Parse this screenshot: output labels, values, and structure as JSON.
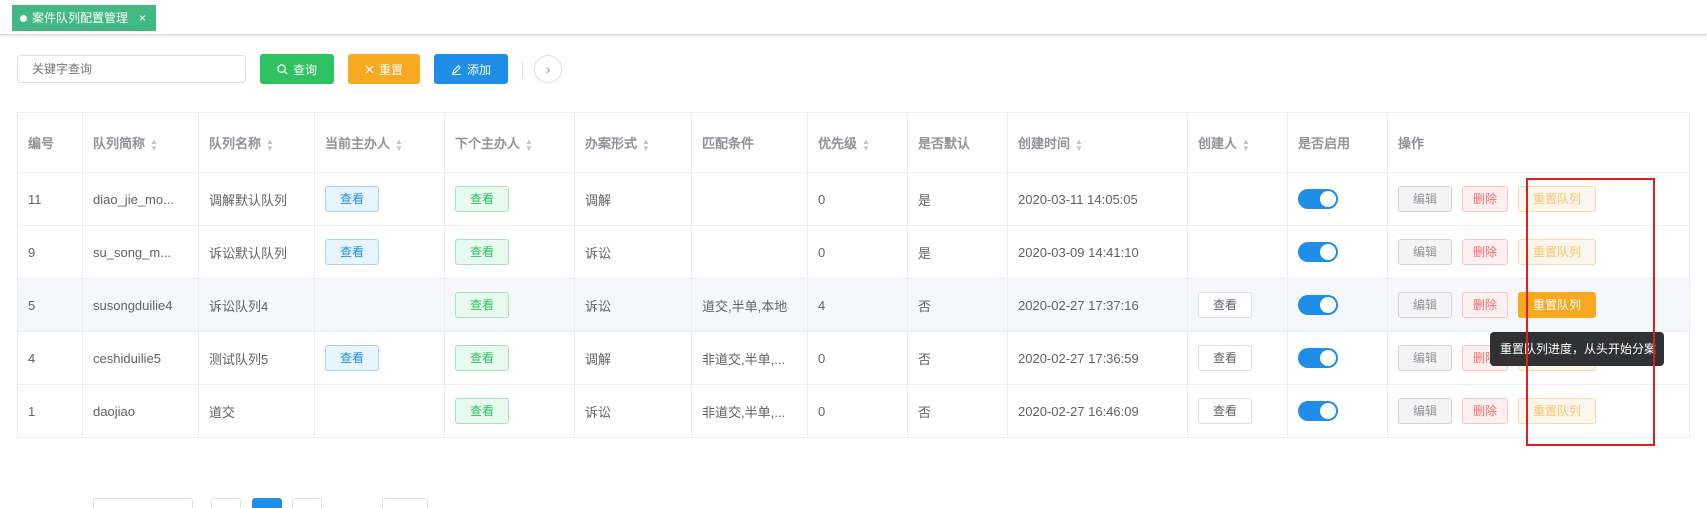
{
  "tab": {
    "label": "案件队列配置管理",
    "close": "×"
  },
  "toolbar": {
    "search_placeholder": "关键字查询",
    "query_label": "查询",
    "reset_label": "重置",
    "add_label": "添加"
  },
  "table": {
    "headers": [
      "编号",
      "队列简称",
      "队列名称",
      "当前主办人",
      "下个主办人",
      "办案形式",
      "匹配条件",
      "优先级",
      "是否默认",
      "创建时间",
      "创建人",
      "是否启用",
      "操作"
    ],
    "view_label": "查看",
    "edit_label": "编辑",
    "delete_label": "删除",
    "reset_queue_label": "重置队列",
    "rows": [
      {
        "id": "11",
        "short": "diao_jie_mo...",
        "name": "调解默认队列",
        "form": "调解",
        "match": "",
        "priority": "0",
        "default": "是",
        "created": "2020-03-11 14:05:05",
        "enabled": true
      },
      {
        "id": "9",
        "short": "su_song_m...",
        "name": "诉讼默认队列",
        "form": "诉讼",
        "match": "",
        "priority": "0",
        "default": "是",
        "created": "2020-03-09 14:41:10",
        "enabled": true
      },
      {
        "id": "5",
        "short": "susongduilie4",
        "name": "诉讼队列4",
        "form": "诉讼",
        "match": "道交,半单,本地",
        "priority": "4",
        "default": "否",
        "created": "2020-02-27 17:37:16",
        "enabled": true
      },
      {
        "id": "4",
        "short": "ceshiduilie5",
        "name": "测试队列5",
        "form": "调解",
        "match": "非道交,半单,...",
        "priority": "0",
        "default": "否",
        "created": "2020-02-27 17:36:59",
        "enabled": true
      },
      {
        "id": "1",
        "short": "daojiao",
        "name": "道交",
        "form": "诉讼",
        "match": "非道交,半单,...",
        "priority": "0",
        "default": "否",
        "created": "2020-02-27 16:46:09",
        "enabled": true
      }
    ]
  },
  "tooltip": "重置队列进度，从头开始分案",
  "colors": {
    "primary": "#1e8ee8",
    "success": "#2fc262",
    "warning": "#f7a91f",
    "danger": "#f56c6c",
    "tag": "#42b983",
    "highlight_box": "#e01f1f"
  }
}
